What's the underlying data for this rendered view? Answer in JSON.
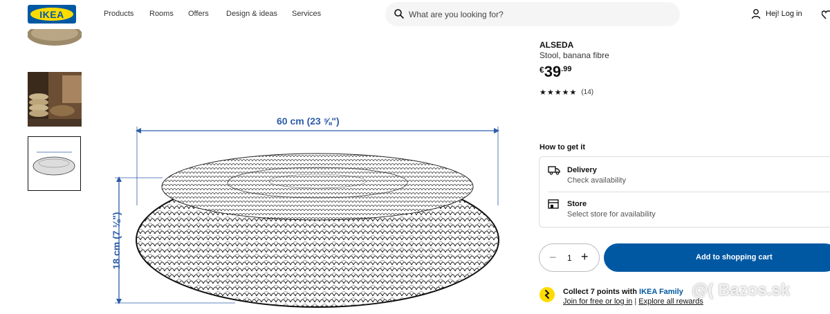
{
  "header": {
    "logo_text": "IKEA",
    "nav": [
      "Products",
      "Rooms",
      "Offers",
      "Design & ideas",
      "Services"
    ],
    "search_placeholder": "What are you looking for?",
    "login_label": "Hej! Log in"
  },
  "gallery": {
    "width_label": "60 cm (23 ⅝\")",
    "height_label": "18 cm (7 ⅛\")"
  },
  "product": {
    "name": "ALSEDA",
    "description": "Stool, banana fibre",
    "price_currency": "€",
    "price_int": "39",
    "price_dec": ".99",
    "rating": 5,
    "review_count": "(14)"
  },
  "fulfilment": {
    "heading": "How to get it",
    "delivery_title": "Delivery",
    "delivery_sub": "Check availability",
    "store_title": "Store",
    "store_sub": "Select store for availability"
  },
  "purchase": {
    "quantity": "1",
    "minus": "−",
    "plus": "+",
    "cart_label": "Add to shopping cart"
  },
  "family": {
    "prefix": "Collect 7 points with ",
    "brand": "IKEA Family",
    "join_link": "Join for free or log in",
    "separator": " | ",
    "explore_link": "Explore all rewards"
  },
  "watermark": "@( Bazos.sk"
}
